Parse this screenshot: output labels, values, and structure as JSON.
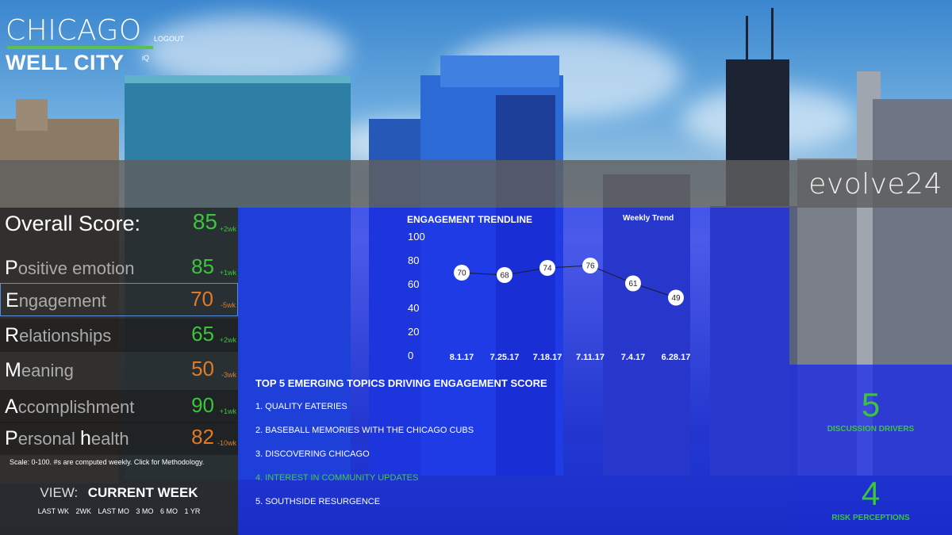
{
  "logo": {
    "city": "CHICAGO",
    "logout": "LOGOUT",
    "well_city": "WELL CITY",
    "iq": "iQ"
  },
  "brand": "evolve24",
  "overall": {
    "label": "Overall Score:",
    "value": "85",
    "change": "+2wk",
    "color": "#3cc43c"
  },
  "scores": [
    {
      "initial": "P",
      "rest": "ositive emotion",
      "value": "85",
      "change": "+1wk",
      "tone": "green"
    },
    {
      "initial": "E",
      "rest": "ngagement",
      "value": "70",
      "change": "-5wk",
      "tone": "orange"
    },
    {
      "initial": "R",
      "rest": "elationships",
      "value": "65",
      "change": "+2wk",
      "tone": "green"
    },
    {
      "initial": "M",
      "rest": "eaning",
      "value": "50",
      "change": "-3wk",
      "tone": "orange"
    },
    {
      "initial": "A",
      "rest": "ccomplishment",
      "value": "90",
      "change": "+1wk",
      "tone": "green"
    },
    {
      "initial": "P",
      "rest": "ersonal ",
      "initial2": "h",
      "rest2": "ealth",
      "value": "82",
      "change": "-10wk",
      "tone": "orange"
    }
  ],
  "scale_note": "Scale: 0-100. #s are computed weekly.  Click for Methodology.",
  "view": {
    "label": "VIEW:",
    "current": "CURRENT WEEK",
    "options": [
      "LAST WK",
      "2WK",
      "LAST MO",
      "3 MO",
      "6 MO",
      "1 YR"
    ]
  },
  "chart_data": {
    "type": "line",
    "title": "ENGAGEMENT TRENDLINE",
    "subtitle": "Weekly Trend",
    "categories": [
      "8.1.17",
      "7.25.17",
      "7.18.17",
      "7.11.17",
      "7.4.17",
      "6.28.17"
    ],
    "values": [
      70,
      68,
      74,
      76,
      61,
      49
    ],
    "yticks": [
      0,
      20,
      40,
      60,
      80,
      100
    ],
    "ylim": [
      0,
      100
    ],
    "grid": false
  },
  "topics": {
    "title": "TOP 5 EMERGING TOPICS DRIVING ENGAGEMENT SCORE",
    "items": [
      "1. QUALITY EATERIES",
      "2. BASEBALL MEMORIES WITH THE CHICAGO CUBS",
      "3. DISCOVERING CHICAGO",
      "4. INTEREST IN COMMUNITY UPDATES",
      "5. SOUTHSIDE RESURGENCE"
    ],
    "highlight_index": 3
  },
  "kpis": [
    {
      "value": "5",
      "caption": "DISCUSSION DRIVERS"
    },
    {
      "value": "4",
      "caption": "RISK PERCEPTIONS"
    }
  ],
  "colors": {
    "accent_green": "#3cc43c",
    "warn_orange": "#e07a25",
    "panel_blue": "#1928eb"
  }
}
